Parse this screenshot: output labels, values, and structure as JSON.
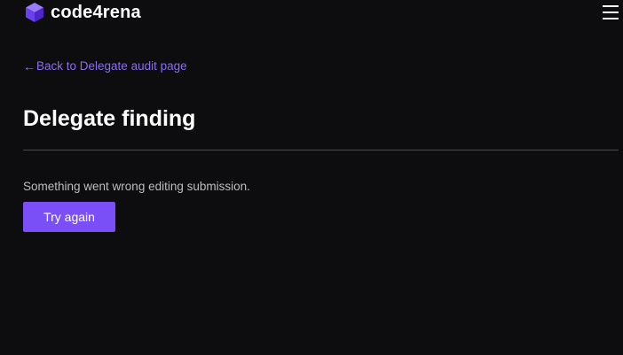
{
  "header": {
    "brand": "code4rena",
    "logo_icon": "cube-logo-icon",
    "menu_icon": "hamburger-menu-icon"
  },
  "nav": {
    "back_arrow": "←",
    "back_label": "Back to Delegate audit page"
  },
  "main": {
    "title": "Delegate finding",
    "error_message": "Something went wrong editing submission.",
    "retry_label": "Try again"
  },
  "colors": {
    "background": "#0d0c0e",
    "accent": "#7a4ff8",
    "link": "#8c6cf3",
    "text_primary": "#ffffff",
    "text_secondary": "#bdbdc2",
    "divider": "#4a4a4e"
  }
}
